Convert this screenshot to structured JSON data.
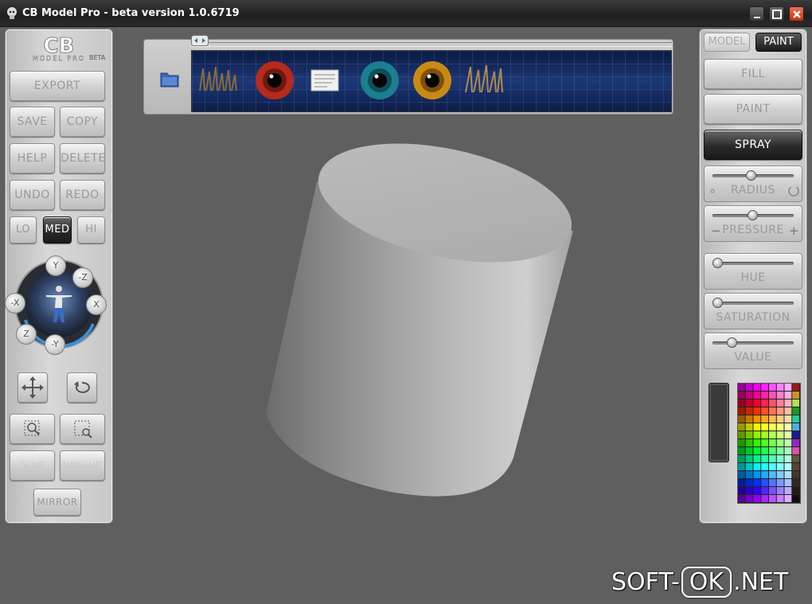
{
  "window": {
    "title": "CB Model Pro - beta version 1.0.6719"
  },
  "logo": {
    "text": "CB",
    "sub": "MODEL PRO",
    "beta": "BETA"
  },
  "left_panel": {
    "export": "EXPORT",
    "save": "SAVE",
    "copy": "COPY",
    "help": "HELP",
    "delete": "DELETE",
    "undo": "UNDO",
    "redo": "REDO",
    "lo": "LO",
    "med": "MED",
    "hi": "HI",
    "axes": {
      "y": "Y",
      "neg_z": "-Z",
      "neg_x": "-X",
      "x": "X",
      "z": "Z",
      "neg_y": "-Y"
    },
    "glue": "GLUE",
    "unglue": "UNGLUE",
    "mirror": "MIRROR"
  },
  "right_panel": {
    "tab_model": "MODEL",
    "tab_paint": "PAINT",
    "fill": "FILL",
    "paint": "PAINT",
    "spray": "SPRAY",
    "radius": {
      "label": "RADIUS",
      "value": 0.45
    },
    "pressure": {
      "label": "PRESSURE",
      "value": 0.48
    },
    "hue": {
      "label": "HUE",
      "value": 0.0
    },
    "saturation": {
      "label": "SATURATION",
      "value": 0.0
    },
    "value": {
      "label": "VALUE",
      "value": 0.2
    }
  },
  "texture_strip": {
    "items": [
      "grass-texture",
      "red-eye-texture",
      "document-texture",
      "teal-eye-texture",
      "amber-eye-texture",
      "grass-texture"
    ],
    "doc_label": "text texture"
  },
  "watermark": {
    "left": "SOFT-",
    "middle": "OK",
    "right": ".NET"
  },
  "colors": {
    "spray_active": "#2a2a2a",
    "cylinder": "#b3b3b3",
    "viewport": "#5f5f5f"
  }
}
